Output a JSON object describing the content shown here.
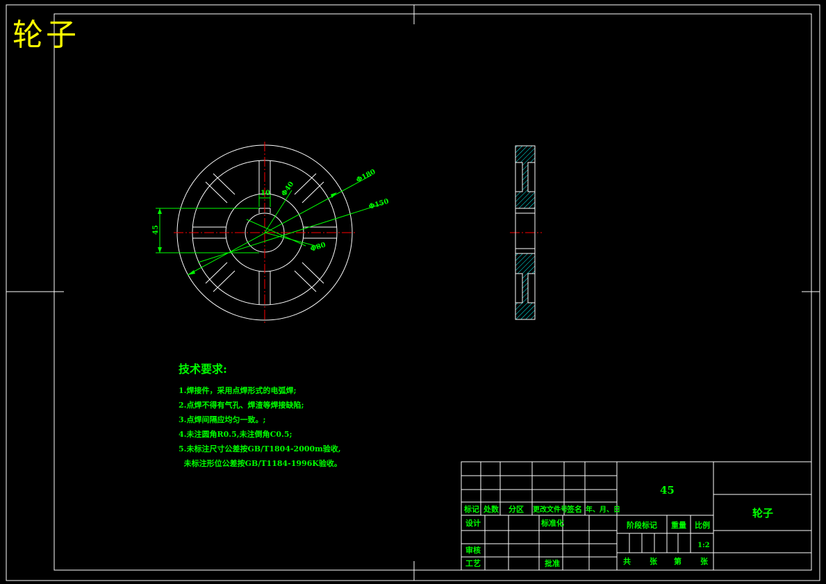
{
  "title": "轮子",
  "dimensions": {
    "d180": "Φ180",
    "d150": "Φ150",
    "d40": "Φ40",
    "d80": "Φ80",
    "w10": "10",
    "h45": "45"
  },
  "notes": {
    "heading": "技术要求:",
    "lines": [
      "1.焊接件，采用点焊形式的电弧焊;",
      "2.点焊不得有气孔、焊渣等焊接缺陷;",
      "3.点焊间隔应均匀一致。;",
      "4.未注圆角R0.5,未注倒角C0.5;",
      "5.未标注尺寸公差按GB/T1804-2000m验收,",
      "  未标注形位公差按GB/T1184-1996K验收。"
    ]
  },
  "title_block": {
    "material": "45",
    "part_name": "轮子",
    "labels": {
      "mark": "标记",
      "count": "处数",
      "zone": "分区",
      "change_doc": "更改文件号",
      "signature": "签名",
      "date": "年、月、日",
      "design": "设计",
      "standardize": "标准化",
      "review": "审核",
      "process": "工艺",
      "approve": "批准",
      "stage_mark": "阶段标记",
      "weight": "重量",
      "scale": "比例",
      "scale_value": "1:2",
      "total": "共",
      "sheets": "张",
      "sheet_no": "第",
      "sheet_unit": "张"
    }
  },
  "colors": {
    "background": "#000000",
    "outline": "#ffffff",
    "dimension": "#00ff00",
    "centerline": "#ff0000",
    "hatch": "#00ffff",
    "title_text": "#ffff00"
  }
}
